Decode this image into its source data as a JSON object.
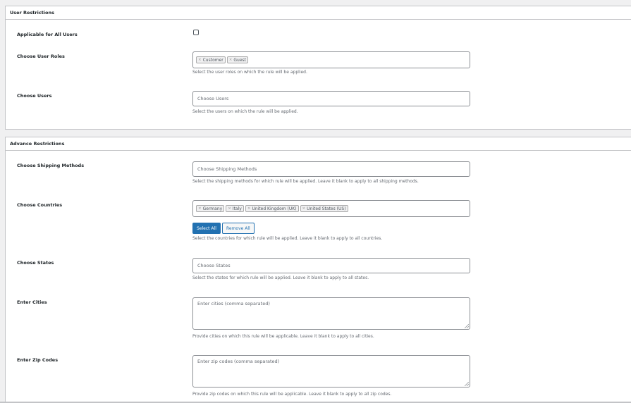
{
  "user_restrictions": {
    "title": "User Restrictions",
    "all_users": {
      "label": "Applicable for All Users",
      "checked": false
    },
    "roles": {
      "label": "Choose User Roles",
      "tags": [
        "Customer",
        "Guest"
      ],
      "help": "Select the user roles on which the rule will be applied."
    },
    "users": {
      "label": "Choose Users",
      "placeholder": "Choose Users",
      "help": "Select the users on which the rule will be applied."
    }
  },
  "advance_restrictions": {
    "title": "Advance Restrictions",
    "shipping": {
      "label": "Choose Shipping Methods",
      "placeholder": "Choose Shipping Methods",
      "help": "Select the shipping methods for which rule will be applied. Leave it blank to apply to all shipping methods."
    },
    "countries": {
      "label": "Choose Countries",
      "tags": [
        "Germany",
        "Italy",
        "United Kingdom (UK)",
        "United States (US)"
      ],
      "select_all": "Select All",
      "remove_all": "Remove All",
      "help": "Select the countries for which rule will be applied. Leave it blank to apply to all countries."
    },
    "states": {
      "label": "Choose States",
      "placeholder": "Choose States",
      "help": "Select the states for which rule will be applied. Leave it blank to apply to all states."
    },
    "cities": {
      "label": "Enter Cities",
      "placeholder": "Enter cities (comma separated)",
      "help": "Provide cities on which this rule will be applicable. Leave it blank to apply to all cities."
    },
    "zips": {
      "label": "Enter Zip Codes",
      "placeholder": "Enter zip codes (comma separated)",
      "help": "Provide zip codes on which this rule will be applicable. Leave it blank to apply to all zip codes."
    }
  },
  "colors": {
    "accent": "#2271b1",
    "border": "#c3c4c7",
    "help_text": "#646970"
  }
}
